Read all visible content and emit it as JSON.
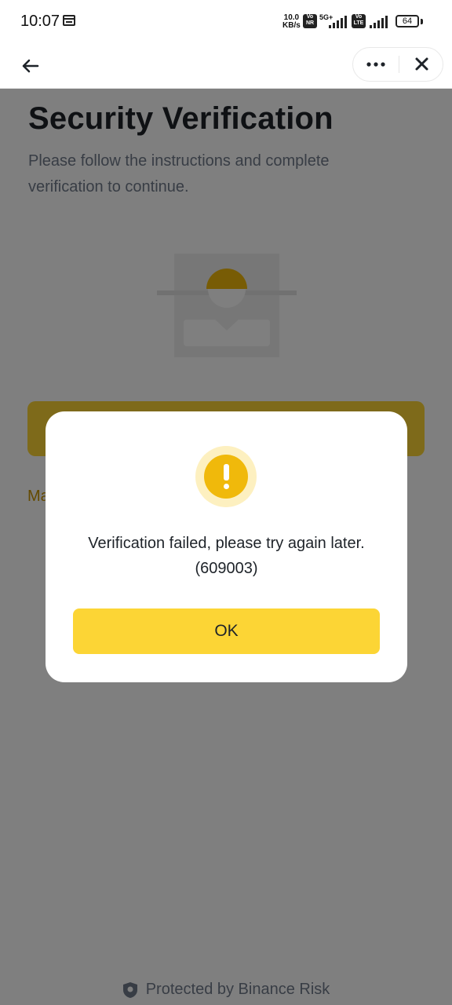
{
  "status_bar": {
    "time": "10:07",
    "net_speed": "10.0",
    "net_unit": "KB/s",
    "badge_vonr": "Vo NR",
    "badge_volte": "Vo LTE",
    "network": "5G+",
    "battery": "64",
    "icons": [
      "calendar-icon",
      "signal-icon",
      "battery-icon"
    ]
  },
  "header": {
    "icons": [
      "back-arrow-icon",
      "more-dots-icon",
      "close-icon"
    ]
  },
  "page": {
    "title": "Security Verification",
    "subtitle": "Please follow the instructions and complete verification to continue.",
    "link_partial": "Ma",
    "footer": "Protected by Binance Risk",
    "footer_icon": "shield-icon"
  },
  "dialog": {
    "icon": "warning-icon",
    "message_line1": "Verification failed, please try again later.",
    "message_line2": "(609003)",
    "ok_label": "OK"
  },
  "colors": {
    "accent": "#fcd535",
    "warning": "#f0b90b",
    "text": "#1e2329",
    "secondary_text": "#707a8a",
    "overlay": "rgba(0,0,0,0.5)"
  }
}
